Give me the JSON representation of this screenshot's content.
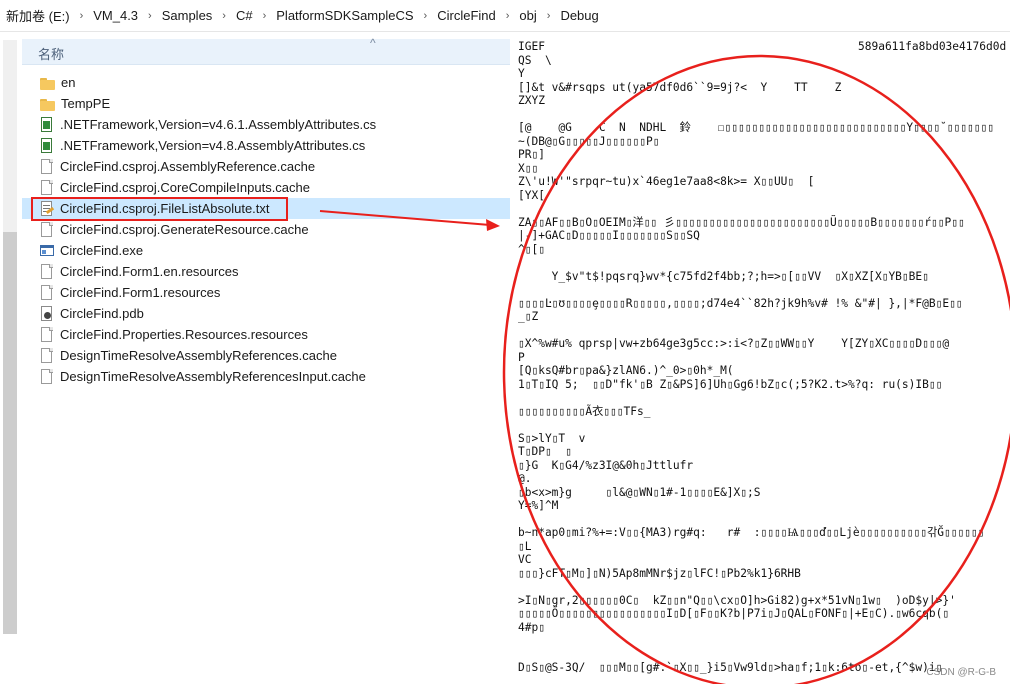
{
  "breadcrumb": [
    "新加卷 (E:)",
    "VM_4.3",
    "Samples",
    "C#",
    "PlatformSDKSampleCS",
    "CircleFind",
    "obj",
    "Debug"
  ],
  "list_header": {
    "name_column": "名称",
    "sort_indicator": "^"
  },
  "files": [
    {
      "name": "en",
      "icon": "folder-icon"
    },
    {
      "name": "TempPE",
      "icon": "folder-icon"
    },
    {
      "name": ".NETFramework,Version=v4.6.1.AssemblyAttributes.cs",
      "icon": "cs-file-icon"
    },
    {
      "name": ".NETFramework,Version=v4.8.AssemblyAttributes.cs",
      "icon": "cs-file-icon"
    },
    {
      "name": "CircleFind.csproj.AssemblyReference.cache",
      "icon": "file-icon"
    },
    {
      "name": "CircleFind.csproj.CoreCompileInputs.cache",
      "icon": "file-icon"
    },
    {
      "name": "CircleFind.csproj.FileListAbsolute.txt",
      "icon": "text-file-icon",
      "selected": true
    },
    {
      "name": "CircleFind.csproj.GenerateResource.cache",
      "icon": "file-icon"
    },
    {
      "name": "CircleFind.exe",
      "icon": "exe-icon"
    },
    {
      "name": "CircleFind.Form1.en.resources",
      "icon": "file-icon"
    },
    {
      "name": "CircleFind.Form1.resources",
      "icon": "file-icon"
    },
    {
      "name": "CircleFind.pdb",
      "icon": "pdb-icon"
    },
    {
      "name": "CircleFind.Properties.Resources.resources",
      "icon": "file-icon"
    },
    {
      "name": "DesignTimeResolveAssemblyReferences.cache",
      "icon": "file-icon"
    },
    {
      "name": "DesignTimeResolveAssemblyReferencesInput.cache",
      "icon": "file-icon"
    }
  ],
  "content": {
    "hash": "589a611fa8bd03e4176d0d",
    "text": "IGEF\nQS  \\\nY\n[]&t v&#rsqps ut(ya57df0d6``9=9j?<  Y    TT    Z\nZXYZ\n\n[@    @G    C  N  NDHL  鈴    ☐▯▯▯▯▯▯▯▯▯▯▯▯▯▯▯▯▯▯▯▯▯▯▯▯▯▯▯Y▯▯▯▯˘▯▯▯▯▯▯▯\n~(DB@▯G▯▯▯▯▯J▯▯▯▯▯▯P▯\nPR▯]\nX▯▯\nZ\\'u!W'\"srpqr~tu)x`46eg1e7aa8<8k>= X▯▯UU▯  [\n[YX[\n\nZA▯▯AF▯▯B▯O▯OEIM▯洋▯▯ 彡▯▯▯▯▯▯▯▯▯▯▯▯▯▯▯▯▯▯▯▯▯▯▯Ũ▯▯▯▯▯B▯▯▯▯▯▯▯ŕ▯▯P▯▯\n|-]+GAC▯D▯▯▯▯▯I▯▯▯▯▯▯▯S▯▯SQ\n^▯[▯\n\n     Y_$v\"t$!pqsrq}wv*{c75fd2f4bb;?;h=>▯[▯▯VV  ▯X▯XZ[X▯YB▯BE▯\n\n▯▯▯▯Ŀ▯ʊ▯▯▯▯ȩ▯▯▯▯R▯▯▯▯▯,▯▯▯▯;d74e4``82h?jk9h%v# !% &\"#| },|*F@B▯E▯▯\n_▯Z\n\n▯X^%w#u% qprsp|vw+zb64ge3g5cc:>:i<?▯Z▯▯WW▯▯Y    Y[ZY▯XC▯▯▯▯D▯▯▯@\nP\n[Q▯ksQ#br▯pa&}zlAN6.)^_0>▯0h*_M(\n1▯T▯IQ 5;  ▯▯D\"fk'▯B Z▯&PS]6]Uh▯Gg6!bZ▯c(;5?K2.t>%?q: ru(s)IB▯▯\n\n▯▯▯▯▯▯▯▯▯▯Ã衣▯▯▯TFs_\n\nS▯>lY▯T  v\nT▯DP▯  ▯\n▯}G  K▯G4/%z3I@&0h▯Jttlufr\n@.\n▯b<x>m}g     ▯l&@▯WN▯1#-1▯▯▯▯E&]X▯;S\nY=%]^M\n\nb~n*ap0▯mi?%+=:V▯▯{MA3)rg#q:   r#  :▯▯▯▯Ѩ▯▯▯ď▯▯Ljè▯▯▯▯▯▯▯▯▯▯갂Ğ▯▯▯▯▯▯\n▯L\nVC\n▯▯▯}cFT▯M▯]▯N)5Ap8mMNr$jz▯lFC!▯Pb2%k1}6RHB\n\n>I▯N▯gr,2▯▯▯▯▯▯0C▯  kZ▯▯n\"Q▯▯\\cx▯O]h>Gi82)g+x*51vN▯1w▯  )oD$y|>}'\n▯▯▯▯▯Ő▯▯▯▯▯▯▯▯▯▯▯▯▯▯▯▯I▯D[▯F▯▯K?b|P7i▯J▯QAL▯FONF▯|+E▯C).▯w6cqb(▯\n4#p▯\n\n\nD▯S▯@S-3Q/  ▯▯▯M▯▯[g#.`▯X▯▯_}i5▯Vw9ld▯>ha▯f;1▯k:6to▯-et,{^$w)i▯\n\n▯▯▯▯▯▯▯▯▯▯▯▯▯▯▯▯Ţ▯▯▯▯X▯RF▯▯o$▯MV▯]+▯P"
  },
  "watermark": "CSDN @R-G-B",
  "colors": {
    "selection": "#cce8ff",
    "annotation_red": "#e8201c",
    "header_bg": "#e9f2fb"
  }
}
